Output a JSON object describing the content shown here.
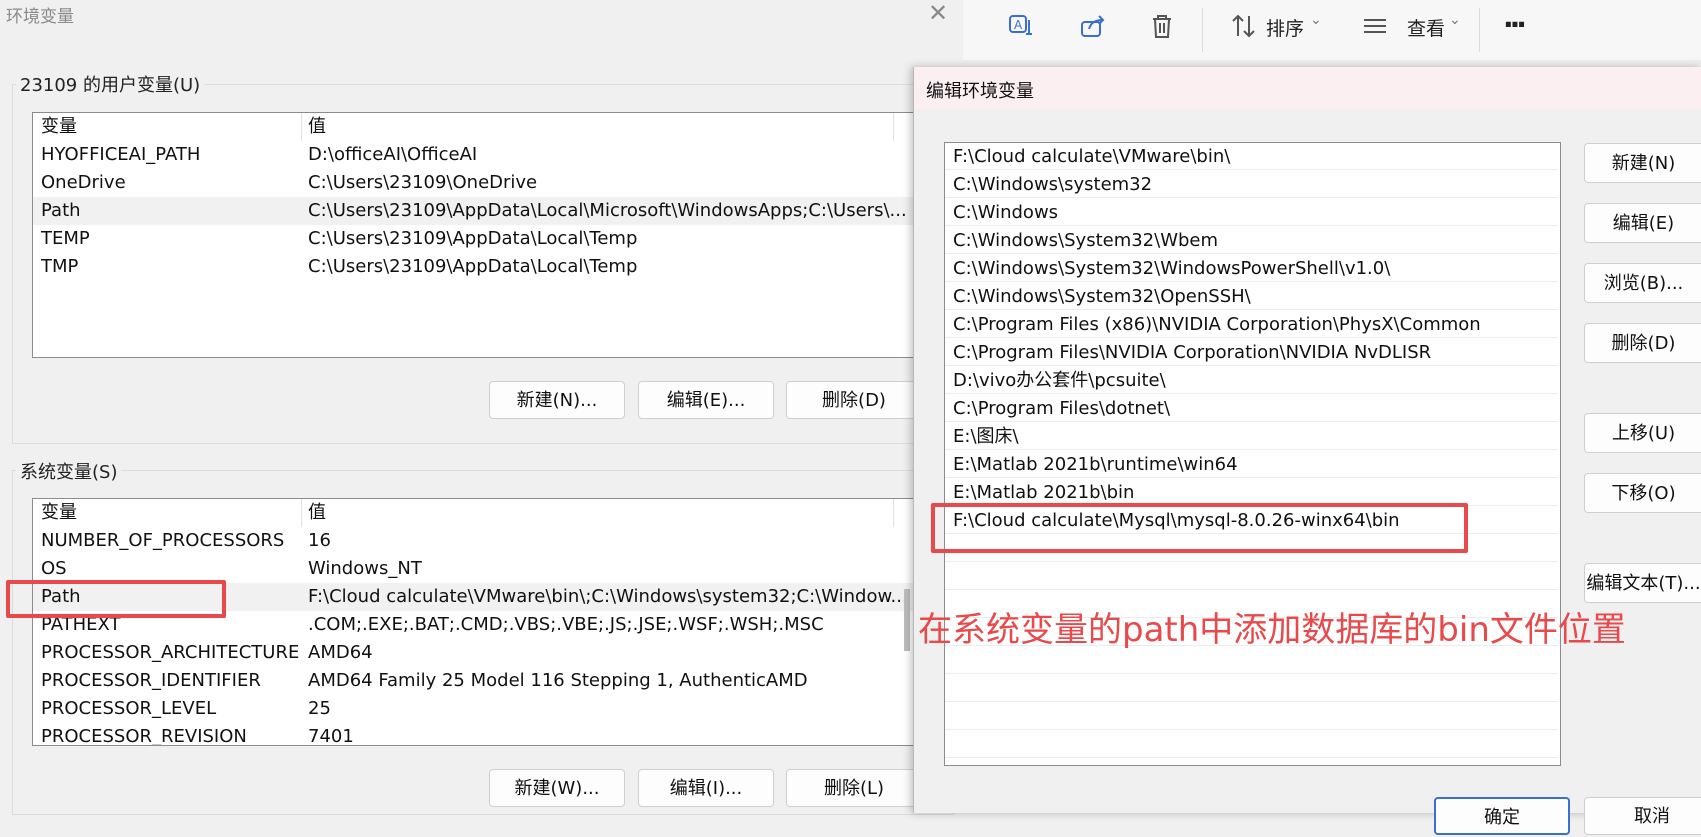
{
  "env_window": {
    "title": "环境变量",
    "user_group_label": "23109 的用户变量(U)",
    "system_group_label": "系统变量(S)",
    "col_variable": "变量",
    "col_value": "值",
    "user_vars": [
      {
        "name": "HYOFFICEAI_PATH",
        "value": "D:\\officeAI\\OfficeAI"
      },
      {
        "name": "OneDrive",
        "value": "C:\\Users\\23109\\OneDrive"
      },
      {
        "name": "Path",
        "value": "C:\\Users\\23109\\AppData\\Local\\Microsoft\\WindowsApps;C:\\Users\\..."
      },
      {
        "name": "TEMP",
        "value": "C:\\Users\\23109\\AppData\\Local\\Temp"
      },
      {
        "name": "TMP",
        "value": "C:\\Users\\23109\\AppData\\Local\\Temp"
      }
    ],
    "system_vars": [
      {
        "name": "NUMBER_OF_PROCESSORS",
        "value": "16"
      },
      {
        "name": "OS",
        "value": "Windows_NT"
      },
      {
        "name": "Path",
        "value": "F:\\Cloud calculate\\VMware\\bin\\;C:\\Windows\\system32;C:\\Window..."
      },
      {
        "name": "PATHEXT",
        "value": ".COM;.EXE;.BAT;.CMD;.VBS;.VBE;.JS;.JSE;.WSF;.WSH;.MSC"
      },
      {
        "name": "PROCESSOR_ARCHITECTURE",
        "value": "AMD64"
      },
      {
        "name": "PROCESSOR_IDENTIFIER",
        "value": "AMD64 Family 25 Model 116 Stepping 1, AuthenticAMD"
      },
      {
        "name": "PROCESSOR_LEVEL",
        "value": "25"
      },
      {
        "name": "PROCESSOR_REVISION",
        "value": "7401"
      }
    ],
    "user_buttons": {
      "new": "新建(N)...",
      "edit": "编辑(E)...",
      "delete": "删除(D)"
    },
    "system_buttons": {
      "new": "新建(W)...",
      "edit": "编辑(I)...",
      "delete": "删除(L)"
    }
  },
  "toolbar": {
    "sort_label": "排序",
    "view_label": "查看",
    "more_label": "···",
    "icons": [
      "translate-icon",
      "share-icon",
      "trash-icon",
      "sort-icon",
      "view-icon",
      "more-icon"
    ]
  },
  "edit_dialog": {
    "title": "编辑环境变量",
    "paths": [
      "F:\\Cloud calculate\\VMware\\bin\\",
      "C:\\Windows\\system32",
      "C:\\Windows",
      "C:\\Windows\\System32\\Wbem",
      "C:\\Windows\\System32\\WindowsPowerShell\\v1.0\\",
      "C:\\Windows\\System32\\OpenSSH\\",
      "C:\\Program Files (x86)\\NVIDIA Corporation\\PhysX\\Common",
      "C:\\Program Files\\NVIDIA Corporation\\NVIDIA NvDLISR",
      "D:\\vivo办公套件\\pcsuite\\",
      "C:\\Program Files\\dotnet\\",
      "E:\\图床\\",
      "E:\\Matlab 2021b\\runtime\\win64",
      "E:\\Matlab 2021b\\bin",
      "F:\\Cloud calculate\\Mysql\\mysql-8.0.26-winx64\\bin",
      "",
      "",
      "",
      "",
      "",
      "",
      "",
      "",
      ""
    ],
    "buttons": {
      "new": "新建(N)",
      "edit": "编辑(E)",
      "browse": "浏览(B)...",
      "delete": "删除(D)",
      "move_up": "上移(U)",
      "move_down": "下移(O)",
      "edit_text": "编辑文本(T)...",
      "ok": "确定",
      "cancel": "取消"
    }
  },
  "annotation": {
    "text": "在系统变量的path中添加数据库的bin文件位置",
    "color": "#e8494b"
  }
}
